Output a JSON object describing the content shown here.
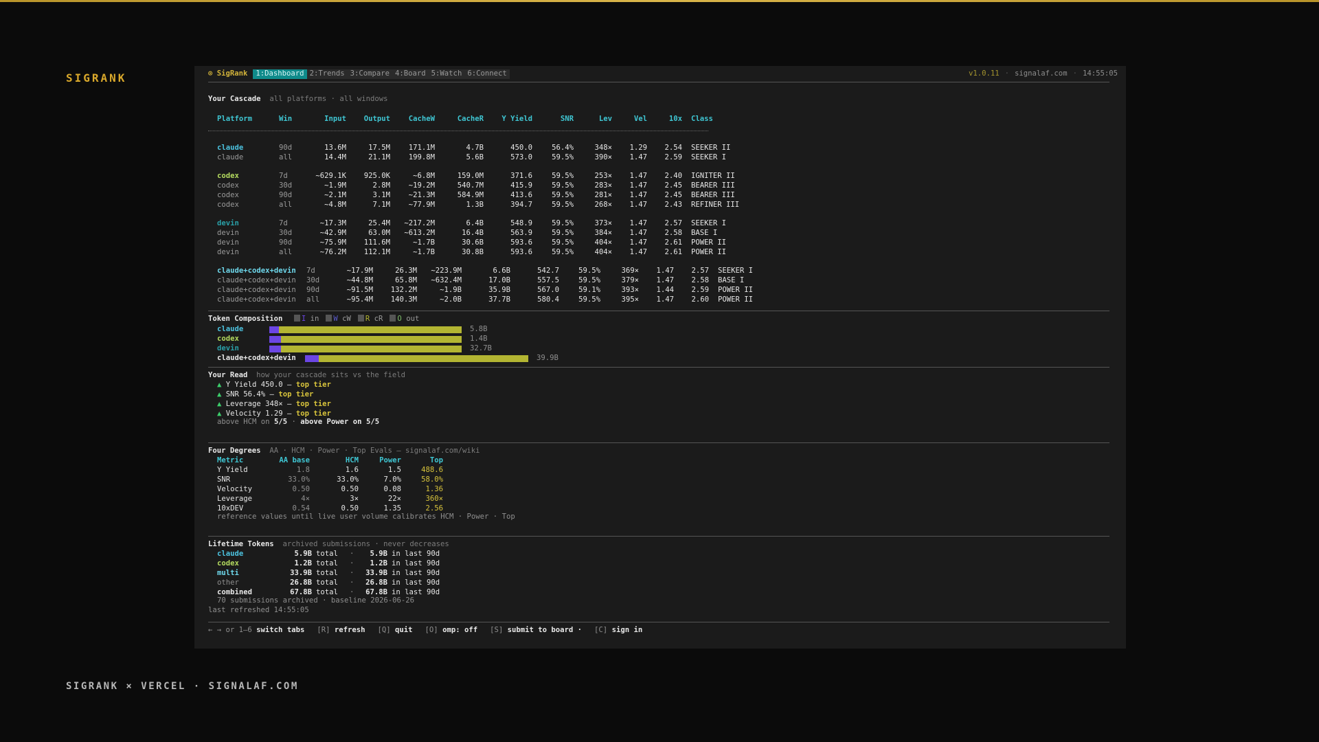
{
  "brand": "SIGRANK",
  "footer_brand": "SIGRANK × VERCEL · SIGNALAF.COM",
  "header": {
    "app_name": "⊙ SigRank",
    "tabs": [
      "1:Dashboard",
      "2:Trends",
      "3:Compare",
      "4:Board",
      "5:Watch",
      "6:Connect"
    ],
    "active_tab": "1:Dashboard",
    "version": "v1.0.11",
    "site": "signalaf.com",
    "clock": "14:55:05"
  },
  "cascade": {
    "title": "Your Cascade",
    "subtitle": "all platforms · all windows",
    "columns": [
      "Platform",
      "Win",
      "Input",
      "Output",
      "CacheW",
      "CacheR",
      "Y Yield",
      "SNR",
      "Lev",
      "Vel",
      "10x",
      "Class"
    ],
    "rows": [
      [
        "claude",
        "90d",
        "13.6M",
        "17.5M",
        "171.1M",
        "4.7B",
        "450.0",
        "56.4%",
        "348×",
        "1.29",
        "2.54",
        "SEEKER II"
      ],
      [
        "claude",
        "all",
        "14.4M",
        "21.1M",
        "199.8M",
        "5.6B",
        "573.0",
        "59.5%",
        "390×",
        "1.47",
        "2.59",
        "SEEKER I"
      ],
      [
        "codex",
        "7d",
        "~629.1K",
        "925.0K",
        "~6.8M",
        "159.0M",
        "371.6",
        "59.5%",
        "253×",
        "1.47",
        "2.40",
        "IGNITER II"
      ],
      [
        "codex",
        "30d",
        "~1.9M",
        "2.8M",
        "~19.2M",
        "540.7M",
        "415.9",
        "59.5%",
        "283×",
        "1.47",
        "2.45",
        "BEARER III"
      ],
      [
        "codex",
        "90d",
        "~2.1M",
        "3.1M",
        "~21.3M",
        "584.9M",
        "413.6",
        "59.5%",
        "281×",
        "1.47",
        "2.45",
        "BEARER III"
      ],
      [
        "codex",
        "all",
        "~4.8M",
        "7.1M",
        "~77.9M",
        "1.3B",
        "394.7",
        "59.5%",
        "268×",
        "1.47",
        "2.43",
        "REFINER III"
      ],
      [
        "devin",
        "7d",
        "~17.3M",
        "25.4M",
        "~217.2M",
        "6.4B",
        "548.9",
        "59.5%",
        "373×",
        "1.47",
        "2.57",
        "SEEKER I"
      ],
      [
        "devin",
        "30d",
        "~42.9M",
        "63.0M",
        "~613.2M",
        "16.4B",
        "563.9",
        "59.5%",
        "384×",
        "1.47",
        "2.58",
        "BASE I"
      ],
      [
        "devin",
        "90d",
        "~75.9M",
        "111.6M",
        "~1.7B",
        "30.6B",
        "593.6",
        "59.5%",
        "404×",
        "1.47",
        "2.61",
        "POWER II"
      ],
      [
        "devin",
        "all",
        "~76.2M",
        "112.1M",
        "~1.7B",
        "30.8B",
        "593.6",
        "59.5%",
        "404×",
        "1.47",
        "2.61",
        "POWER II"
      ],
      [
        "claude+codex+devin",
        "7d",
        "~17.9M",
        "26.3M",
        "~223.9M",
        "6.6B",
        "542.7",
        "59.5%",
        "369×",
        "1.47",
        "2.57",
        "SEEKER I"
      ],
      [
        "claude+codex+devin",
        "30d",
        "~44.8M",
        "65.8M",
        "~632.4M",
        "17.0B",
        "557.5",
        "59.5%",
        "379×",
        "1.47",
        "2.58",
        "BASE I"
      ],
      [
        "claude+codex+devin",
        "90d",
        "~91.5M",
        "132.2M",
        "~1.9B",
        "35.9B",
        "567.0",
        "59.1%",
        "393×",
        "1.44",
        "2.59",
        "POWER II"
      ],
      [
        "claude+codex+devin",
        "all",
        "~95.4M",
        "140.3M",
        "~2.0B",
        "37.7B",
        "580.4",
        "59.5%",
        "395×",
        "1.47",
        "2.60",
        "POWER II"
      ]
    ]
  },
  "composition": {
    "title": "Token Composition",
    "legend": [
      {
        "key": "I",
        "label": "in",
        "color": "#6c46e4"
      },
      {
        "key": "W",
        "label": "cW",
        "color": "#5a5acb"
      },
      {
        "key": "R",
        "label": "cR",
        "color": "#b3b532"
      },
      {
        "key": "O",
        "label": "out",
        "color": "#7dbb6a"
      }
    ],
    "bars": [
      {
        "name": "claude",
        "total": "5.8B",
        "in_fraction": 0.05,
        "length_fraction": 0.863
      },
      {
        "name": "codex",
        "total": "1.4B",
        "in_fraction": 0.06,
        "length_fraction": 0.863
      },
      {
        "name": "devin",
        "total": "32.7B",
        "in_fraction": 0.06,
        "length_fraction": 0.863
      },
      {
        "name": "claude+codex+devin",
        "total": "39.9B",
        "in_fraction": 0.06,
        "length_fraction": 1.0
      }
    ]
  },
  "read": {
    "title": "Your Read",
    "subtitle": "how your cascade sits vs the field",
    "items": [
      {
        "text": "Y Yield 450.0 —",
        "tier": "top tier"
      },
      {
        "text": "SNR 56.4% —",
        "tier": "top tier"
      },
      {
        "text": "Leverage 348× —",
        "tier": "top tier"
      },
      {
        "text": "Velocity 1.29 —",
        "tier": "top tier"
      }
    ],
    "summary_a": "above HCM on",
    "summary_b": "5/5",
    "summary_c": "·",
    "summary_d": "above Power on",
    "summary_e": "5/5"
  },
  "degrees": {
    "title": "Four Degrees",
    "subtitle": "AA · HCM · Power · Top Evals — signalaf.com/wiki",
    "columns": [
      "Metric",
      "AA base",
      "HCM",
      "Power",
      "Top"
    ],
    "rows": [
      [
        "Y Yield",
        "1.8",
        "1.6",
        "1.5",
        "488.6"
      ],
      [
        "SNR",
        "33.0%",
        "33.0%",
        "7.0%",
        "58.0%"
      ],
      [
        "Velocity",
        "0.50",
        "0.50",
        "0.08",
        "1.36"
      ],
      [
        "Leverage",
        "4×",
        "3×",
        "22×",
        "360×"
      ],
      [
        "10xDEV",
        "0.54",
        "0.50",
        "1.35",
        "2.56"
      ]
    ],
    "note": "reference values until live user volume calibrates HCM · Power · Top"
  },
  "lifetime": {
    "title": "Lifetime Tokens",
    "subtitle": "archived submissions · never decreases",
    "rows": [
      {
        "name": "claude",
        "total": "5.9B",
        "recent": "5.9B"
      },
      {
        "name": "codex",
        "total": "1.2B",
        "recent": "1.2B"
      },
      {
        "name": "multi",
        "total": "33.9B",
        "recent": "33.9B"
      },
      {
        "name": "other",
        "total": "26.8B",
        "recent": "26.8B"
      },
      {
        "name": "combined",
        "total": "67.8B",
        "recent": "67.8B"
      }
    ],
    "total_word": "total",
    "recent_word": "in last 90d",
    "archived": "70 submissions archived · baseline 2026-06-26",
    "refreshed": "last refreshed 14:55:05"
  },
  "keys": [
    {
      "key": "← → or 1–6",
      "label": "switch tabs"
    },
    {
      "key": "[R]",
      "label": "refresh"
    },
    {
      "key": "[Q]",
      "label": "quit"
    },
    {
      "key": "[O]",
      "label": "omp: off"
    },
    {
      "key": "[S]",
      "label": "submit to board ·"
    },
    {
      "key": "[C]",
      "label": "sign in"
    }
  ],
  "colors": {
    "accent_gold": "#d9a82b",
    "tab_active": "#0f8b8b",
    "header_cyan": "#3fc6d3",
    "bar_in": "#6c46e4",
    "bar_out": "#b3b532"
  }
}
